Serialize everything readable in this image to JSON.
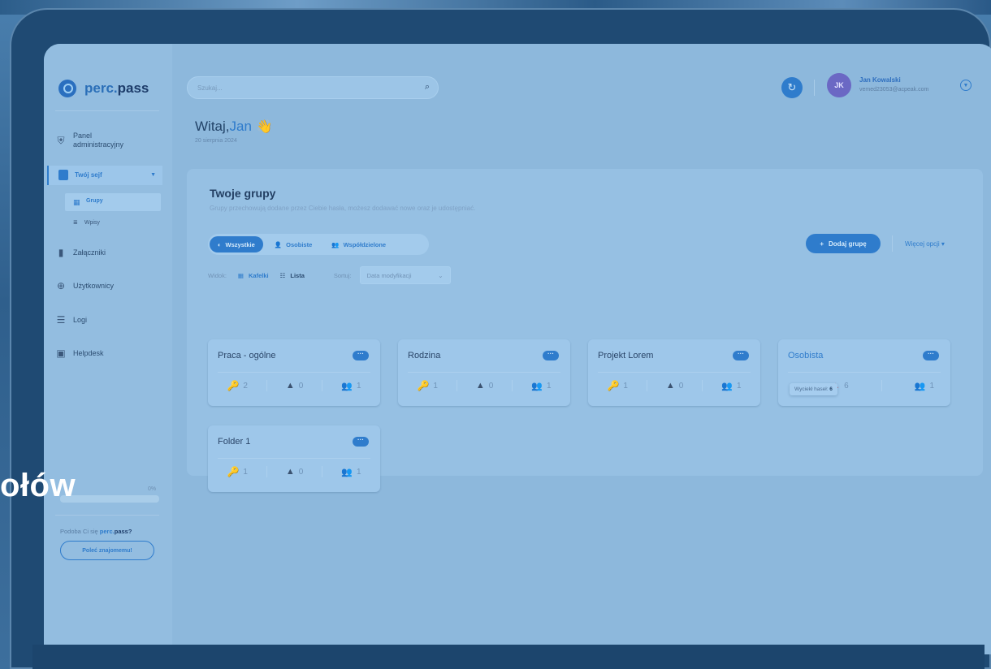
{
  "app": {
    "logo_light": "perc.",
    "logo_bold": "pass"
  },
  "sidebar": {
    "items": [
      {
        "label": "Panel administracyjny",
        "icon": "shield-gear-icon"
      },
      {
        "label": "Twój sejf",
        "icon": "lock-icon",
        "active": true
      },
      {
        "label": "Załączniki",
        "icon": "file-icon"
      },
      {
        "label": "Użytkownicy",
        "icon": "globe-icon"
      },
      {
        "label": "Logi",
        "icon": "filter-lines-icon"
      },
      {
        "label": "Helpdesk",
        "icon": "chat-icon"
      }
    ],
    "sub_items": [
      {
        "label": "Grupy",
        "active": true
      },
      {
        "label": "Wpisy"
      }
    ],
    "progress_label": "0%",
    "progress_value": 0,
    "promo_prefix": "Podoba Ci się",
    "promo_brand_light": "perc.",
    "promo_brand_bold": "pass?",
    "refer_button": "Poleć znajomemu!"
  },
  "header": {
    "search_placeholder": "Szukaj...",
    "avatar_initials": "JK",
    "user_name": "Jan Kowalski",
    "user_email": "vemed23053@acpeak.com"
  },
  "greeting": {
    "prefix": "Witaj,",
    "name": "Jan",
    "emoji": "👋",
    "date": "20 sierpnia 2024"
  },
  "groups": {
    "title": "Twoje grupy",
    "description": "Grupy przechowują dodane przez Ciebie hasła, możesz dodawać nowe oraz je udostępniać.",
    "tabs": [
      "Wszystkie",
      "Osobiste",
      "Współdzielone"
    ],
    "add_button": "Dodaj grupę",
    "more_options": "Więcej opcji",
    "view_label": "Widok:",
    "view_tiles": "Kafelki",
    "view_list": "Lista",
    "sort_label": "Sortuj:",
    "sort_value": "Data modyfikacji",
    "cards": [
      {
        "title": "Praca - ogólne",
        "keys": "2",
        "warnings": "0",
        "users": "1"
      },
      {
        "title": "Rodzina",
        "keys": "1",
        "warnings": "0",
        "users": "1"
      },
      {
        "title": "Projekt Lorem",
        "keys": "1",
        "warnings": "0",
        "users": "1"
      },
      {
        "title": "Osobista",
        "keys": "",
        "warnings": "6",
        "users": "1"
      },
      {
        "title": "Folder 1",
        "keys": "1",
        "warnings": "0",
        "users": "1"
      }
    ],
    "tooltip_label": "Wyciekł haseł:",
    "tooltip_value": "6",
    "menu_dots": "···"
  },
  "overlay_text": "ołów",
  "colors": {
    "accent": "#2f7ccc",
    "avatar": "#6b68c4",
    "warning_red": "#b7505a"
  }
}
